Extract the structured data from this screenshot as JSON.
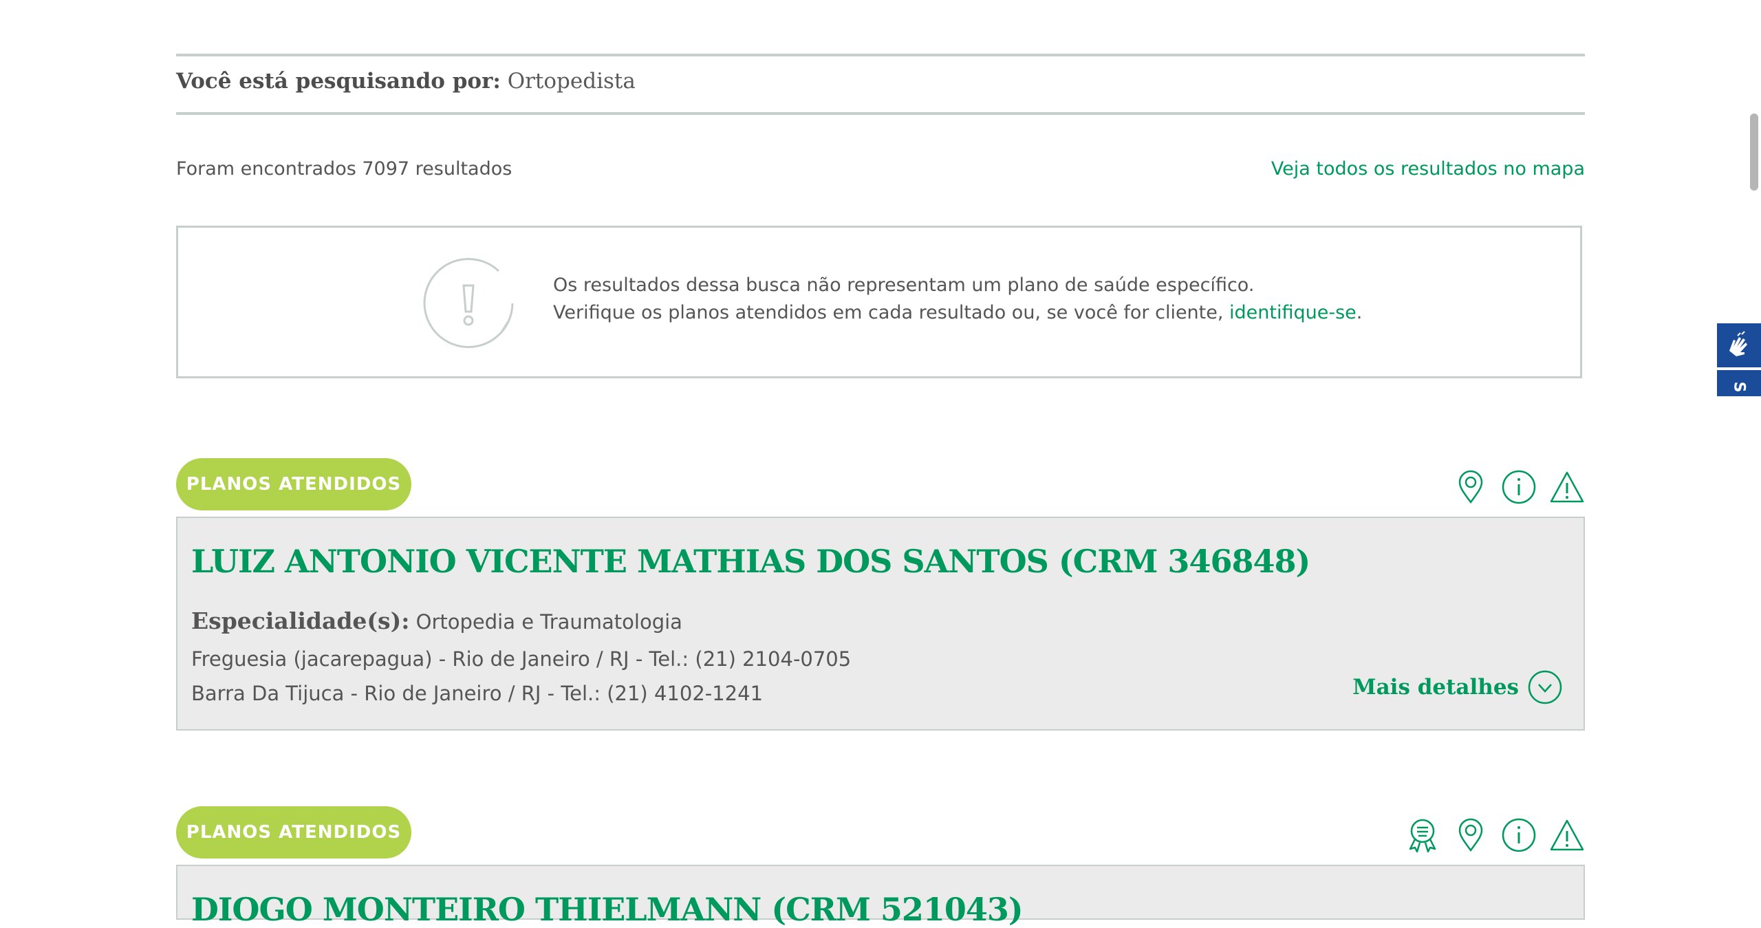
{
  "search": {
    "label": "Você está pesquisando por:",
    "term": "Ortopedista"
  },
  "results": {
    "count_text": "Foram encontrados 7097 resultados",
    "map_link": "Veja todos os resultados no mapa"
  },
  "notice": {
    "icon": "exclamation-circle-icon",
    "line1": "Os resultados dessa busca não representam um plano de saúde específico.",
    "line2_prefix": "Verifique os planos atendidos em cada resultado ou, se você for cliente, ",
    "line2_link": "identifique-se",
    "line2_suffix": "."
  },
  "cards": [
    {
      "pill_label": "PLANOS ATENDIDOS",
      "icons": [
        "map-pin-icon",
        "info-icon",
        "warning-icon"
      ],
      "title": "LUIZ ANTONIO VICENTE MATHIAS DOS SANTOS (CRM 346848)",
      "specialty_label": "Especialidade(s):",
      "specialty": "Ortopedia e Traumatologia",
      "addresses": [
        "Freguesia (jacarepagua) - Rio de Janeiro / RJ - Tel.: (21) 2104-0705",
        "Barra Da Tijuca - Rio de Janeiro / RJ - Tel.: (21) 4102-1241"
      ],
      "more_label": "Mais detalhes"
    },
    {
      "pill_label": "PLANOS ATENDIDOS",
      "icons": [
        "certificate-icon",
        "map-pin-icon",
        "info-icon",
        "warning-icon"
      ],
      "title": "DIOGO MONTEIRO THIELMANN (CRM 521043)"
    }
  ],
  "colors": {
    "green": "#00995d",
    "lime": "#b1d34b",
    "card_bg": "#ebebeb",
    "border": "#c6cfcc",
    "accessibility_blue": "#1b4c9a"
  },
  "accessibility": {
    "icon": "sign-language-icon",
    "tab_letter": "S"
  }
}
